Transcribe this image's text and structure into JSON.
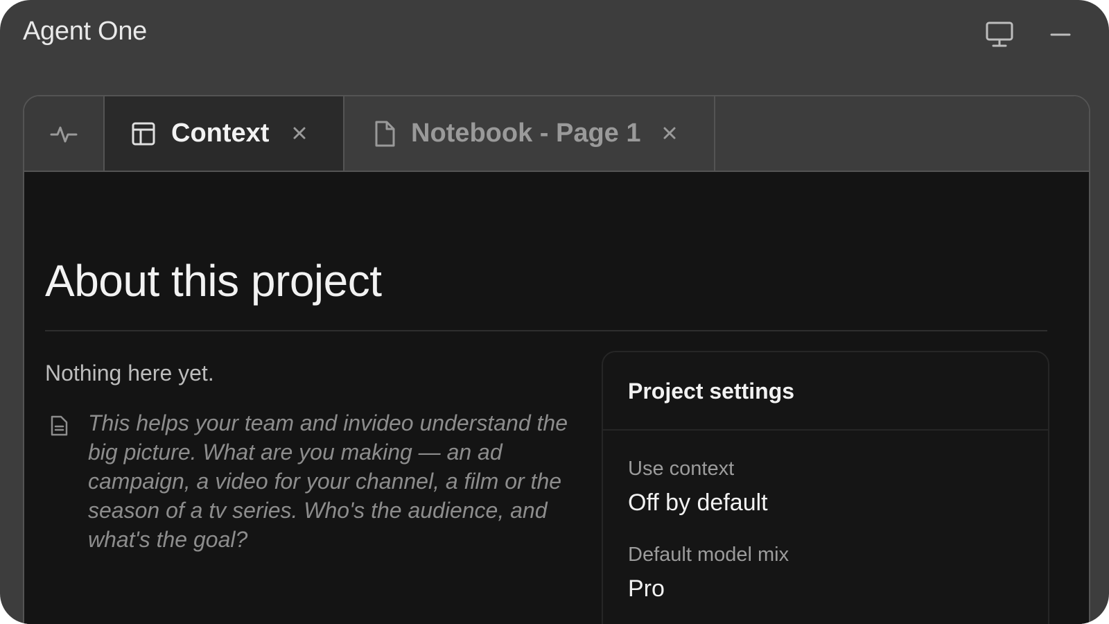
{
  "window": {
    "title": "Agent One",
    "controls": [
      {
        "icon": "monitor-icon"
      },
      {
        "icon": "minimize-icon"
      }
    ]
  },
  "tabs": [
    {
      "icon": "activity-icon"
    },
    {
      "icon": "calendar-icon",
      "label": "Context",
      "active": true
    },
    {
      "icon": "document-icon",
      "label": "Notebook - Page 1",
      "active": false
    }
  ],
  "main": {
    "title": "About this project",
    "empty_state": "Nothing here yet.",
    "hint_icon": "note-icon",
    "hint": "This helps your team and invideo understand the big picture. What are you making — an ad campaign, a video for your channel, a film or the season of a tv series. Who's the audience, and what's the goal?"
  },
  "settings": {
    "title": "Project settings",
    "items": [
      {
        "label": "Use context",
        "value": "Off by default"
      },
      {
        "label": "Default model mix",
        "value": "Pro"
      }
    ]
  },
  "colors": {
    "window_bg": "#3d3d3d",
    "content_bg": "#141414",
    "text_primary": "#f2f2f2",
    "text_muted": "#8d8d8d"
  }
}
